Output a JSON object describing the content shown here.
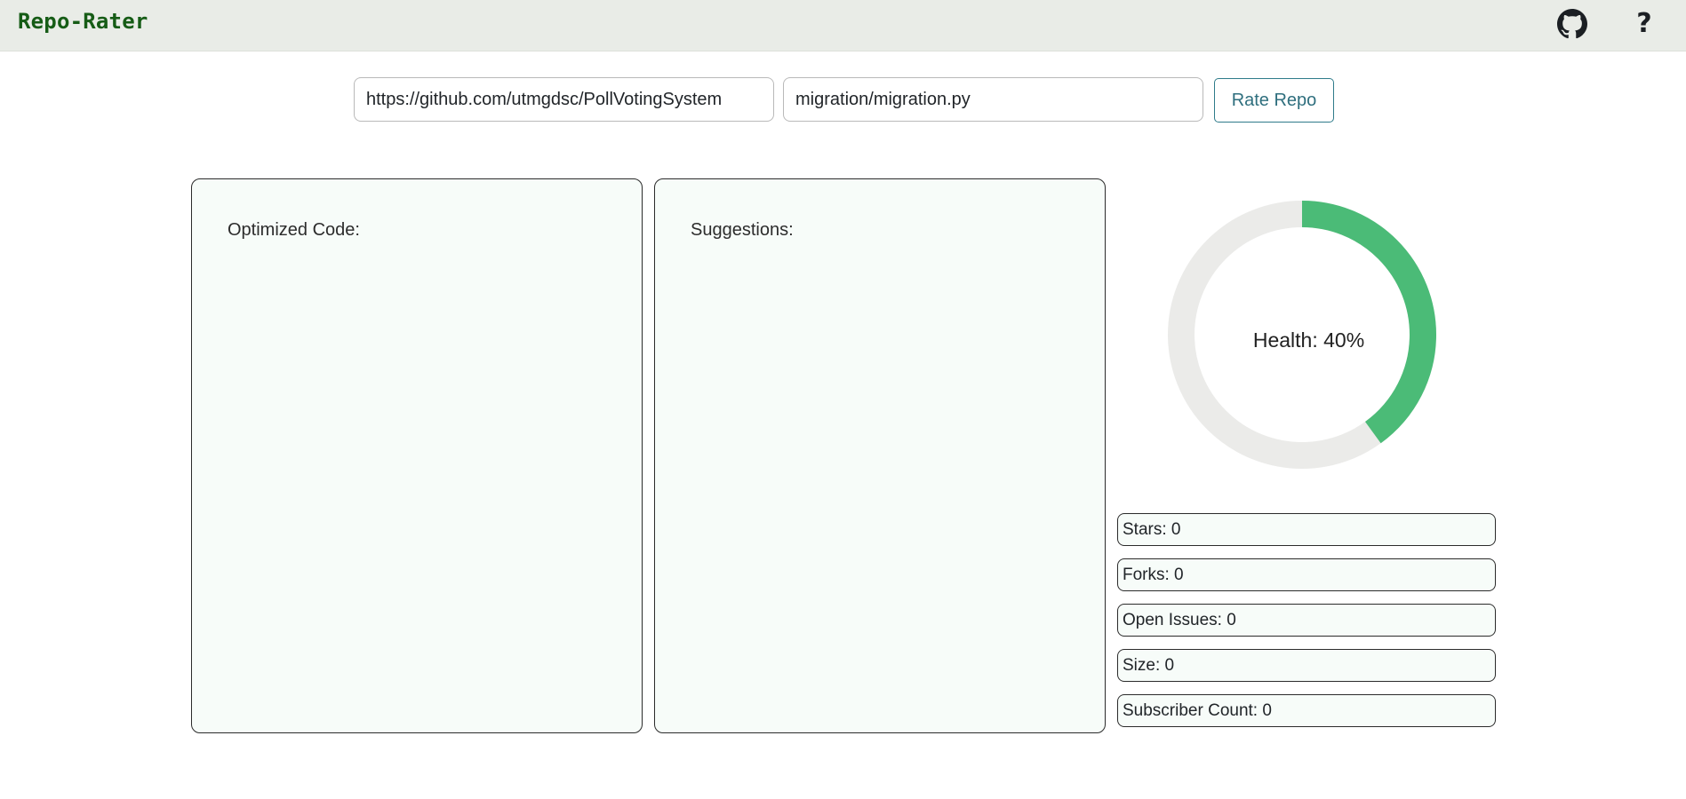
{
  "header": {
    "brand": "Repo-Rater",
    "github_icon": "github-icon",
    "help_icon": "question-mark-icon",
    "help_glyph": "?"
  },
  "search": {
    "repo_url_value": "https://github.com/utmgdsc/PollVotingSystem",
    "file_path_value": "migration/migration.py",
    "rate_button_label": "Rate Repo"
  },
  "panels": {
    "optimized_label": "Optimized Code:",
    "suggestions_label": "Suggestions:"
  },
  "health": {
    "label": "Health: 40%",
    "value": 0.4,
    "fill_color": "#4bbb77",
    "track_color": "#ebebe9"
  },
  "stats": [
    {
      "label": "Stars: 0"
    },
    {
      "label": "Forks: 0"
    },
    {
      "label": "Open Issues: 0"
    },
    {
      "label": "Size: 0"
    },
    {
      "label": "Subscriber Count: 0"
    }
  ],
  "colors": {
    "brand": "#165c16",
    "header_bg": "#e9ece7",
    "panel_bg": "#f7fcf9",
    "button_accent": "#2f6f7e"
  }
}
